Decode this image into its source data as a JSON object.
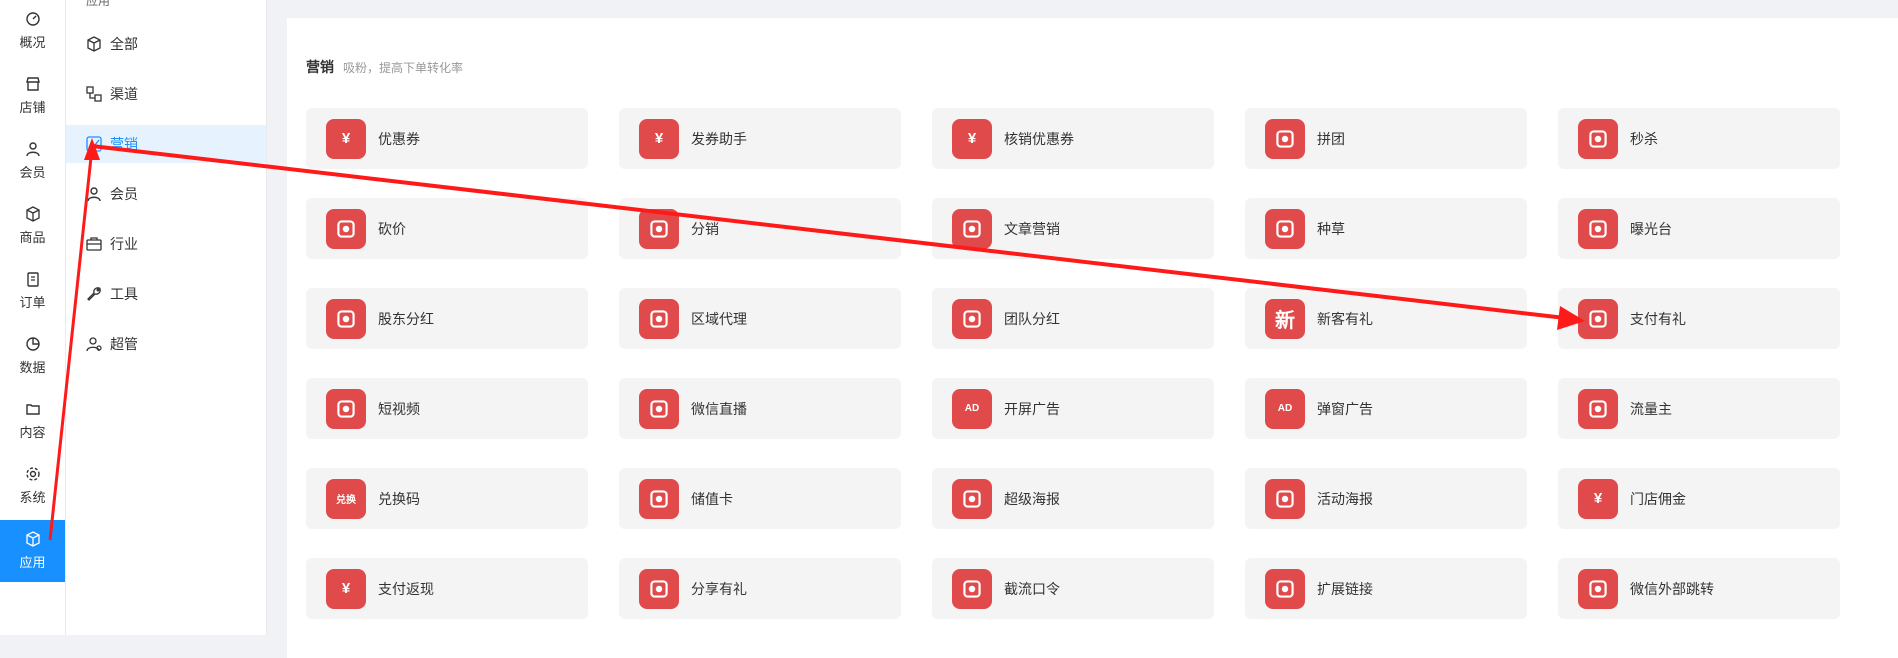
{
  "rail": [
    {
      "label": "概况",
      "icon": "dashboard-icon"
    },
    {
      "label": "店铺",
      "icon": "store-icon"
    },
    {
      "label": "会员",
      "icon": "user-icon"
    },
    {
      "label": "商品",
      "icon": "box-icon"
    },
    {
      "label": "订单",
      "icon": "clipboard-icon"
    },
    {
      "label": "数据",
      "icon": "pie-chart-icon"
    },
    {
      "label": "内容",
      "icon": "folder-icon"
    },
    {
      "label": "系统",
      "icon": "gear-icon"
    },
    {
      "label": "应用",
      "icon": "cube-icon",
      "active": true
    }
  ],
  "submenu": {
    "header": "应用",
    "items": [
      {
        "label": "全部",
        "icon": "cube-icon"
      },
      {
        "label": "渠道",
        "icon": "channel-icon"
      },
      {
        "label": "营销",
        "icon": "trend-icon",
        "active": true
      },
      {
        "label": "会员",
        "icon": "user-icon"
      },
      {
        "label": "行业",
        "icon": "briefcase-icon"
      },
      {
        "label": "工具",
        "icon": "wrench-icon"
      },
      {
        "label": "超管",
        "icon": "admin-icon"
      }
    ]
  },
  "section": {
    "title": "营销",
    "subtitle": "吸粉，提高下单转化率"
  },
  "apps": [
    [
      "优惠券",
      "发券助手",
      "核销优惠券",
      "拼团",
      "秒杀"
    ],
    [
      "砍价",
      "分销",
      "文章营销",
      "种草",
      "曝光台"
    ],
    [
      "股东分红",
      "区域代理",
      "团队分红",
      "新客有礼",
      "支付有礼"
    ],
    [
      "短视频",
      "微信直播",
      "开屏广告",
      "弹窗广告",
      "流量主"
    ],
    [
      "兑换码",
      "储值卡",
      "超级海报",
      "活动海报",
      "门店佣金"
    ],
    [
      "支付返现",
      "分享有礼",
      "截流口令",
      "扩展链接",
      "微信外部跳转"
    ]
  ],
  "icon_glyphs": {
    "新客有礼": "新",
    "优惠券": "¥",
    "发券助手": "¥",
    "核销优惠券": "¥",
    "门店佣金": "¥",
    "支付返现": "¥",
    "开屏广告": "AD",
    "弹窗广告": "AD",
    "兑换码": "兑换"
  },
  "colors": {
    "accent": "#1890ff",
    "icon_bg": "#e14a4a",
    "card_bg": "#f4f4f4",
    "annotation": "#ff1a1a"
  }
}
